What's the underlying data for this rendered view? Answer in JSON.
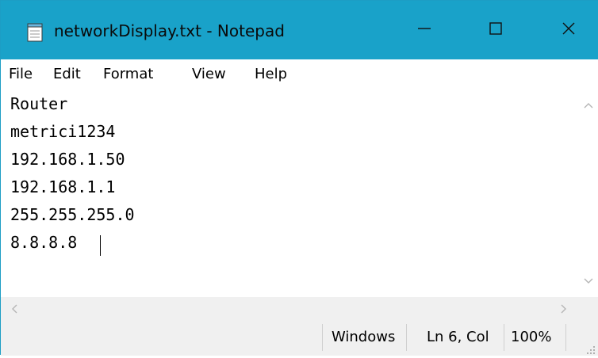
{
  "window": {
    "title": "networkDisplay.txt - Notepad",
    "accent_color": "#19a2c9"
  },
  "titlebar": {
    "app_icon": "notepad-icon",
    "minimize_icon": "minimize-icon",
    "maximize_icon": "maximize-icon",
    "close_icon": "close-icon"
  },
  "menu": {
    "items": [
      {
        "label": "File"
      },
      {
        "label": "Edit"
      },
      {
        "label": "Format"
      },
      {
        "label": "View"
      },
      {
        "label": "Help"
      }
    ]
  },
  "editor": {
    "lines": [
      "Router",
      "metrici1234",
      "192.168.1.50",
      "192.168.1.1",
      "255.255.255.0",
      "8.8.8.8"
    ]
  },
  "scrollbars": {
    "up_icon": "chevron-up-icon",
    "down_icon": "chevron-down-icon",
    "left_icon": "chevron-left-icon",
    "right_icon": "chevron-right-icon"
  },
  "status": {
    "line_ending": "Windows",
    "position": "Ln 6, Col",
    "zoom": "100%"
  }
}
